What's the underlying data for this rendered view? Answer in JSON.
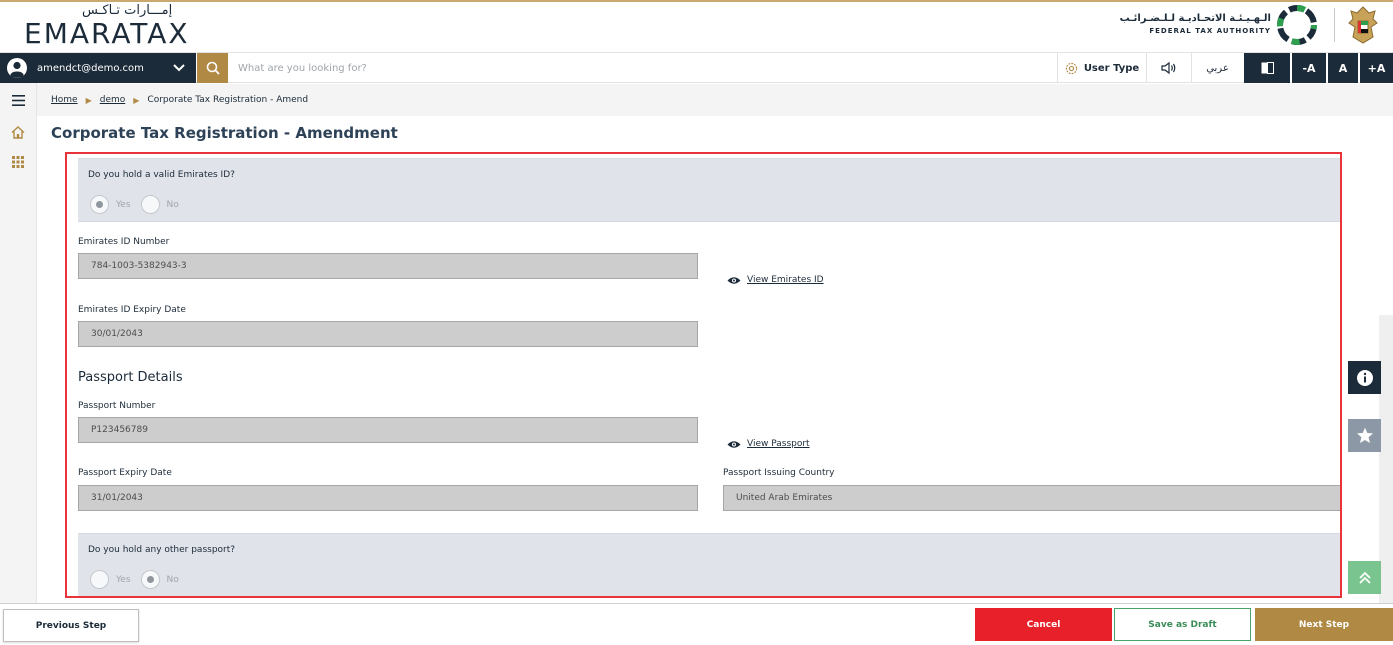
{
  "header": {
    "logo_ar": "إمـــارات تـاكـس",
    "logo_en": "EMARATAX",
    "authority_ar": "الـهـيـئـة الاتحـاديـة لـلـضـرائـب",
    "authority_en": "FEDERAL TAX AUTHORITY"
  },
  "toolbar": {
    "user_email": "amendct@demo.com",
    "search_placeholder": "What are you looking for?",
    "user_type_label": "User Type",
    "arabic_label": "عربي",
    "font_decrease": "-A",
    "font_normal": "A",
    "font_increase": "+A"
  },
  "breadcrumb": {
    "items": [
      "Home",
      "demo",
      "Corporate Tax Registration - Amend"
    ]
  },
  "page": {
    "title": "Corporate Tax Registration - Amendment"
  },
  "form": {
    "emirates_id_question": {
      "label": "Do you hold a valid Emirates ID?",
      "options": [
        "Yes",
        "No"
      ],
      "selected": "Yes"
    },
    "emirates_id_number": {
      "label": "Emirates ID Number",
      "value": "784-1003-5382943-3"
    },
    "view_emirates_id": "View Emirates ID",
    "emirates_id_expiry": {
      "label": "Emirates ID Expiry Date",
      "value": "30/01/2043"
    },
    "passport_section_title": "Passport Details",
    "passport_number": {
      "label": "Passport Number",
      "value": "P123456789"
    },
    "view_passport": "View Passport",
    "passport_expiry": {
      "label": "Passport Expiry Date",
      "value": "31/01/2043"
    },
    "passport_country": {
      "label": "Passport Issuing Country",
      "value": "United Arab Emirates"
    },
    "other_passport_question": {
      "label": "Do you hold any other passport?",
      "options": [
        "Yes",
        "No"
      ],
      "selected": "No"
    }
  },
  "footer": {
    "previous": "Previous Step",
    "cancel": "Cancel",
    "save_draft": "Save as Draft",
    "next": "Next Step"
  },
  "colors": {
    "navy": "#1c2b39",
    "gold": "#b08945",
    "red": "#e8202a",
    "green": "#46a36a",
    "panel_border": "#e8333b"
  }
}
